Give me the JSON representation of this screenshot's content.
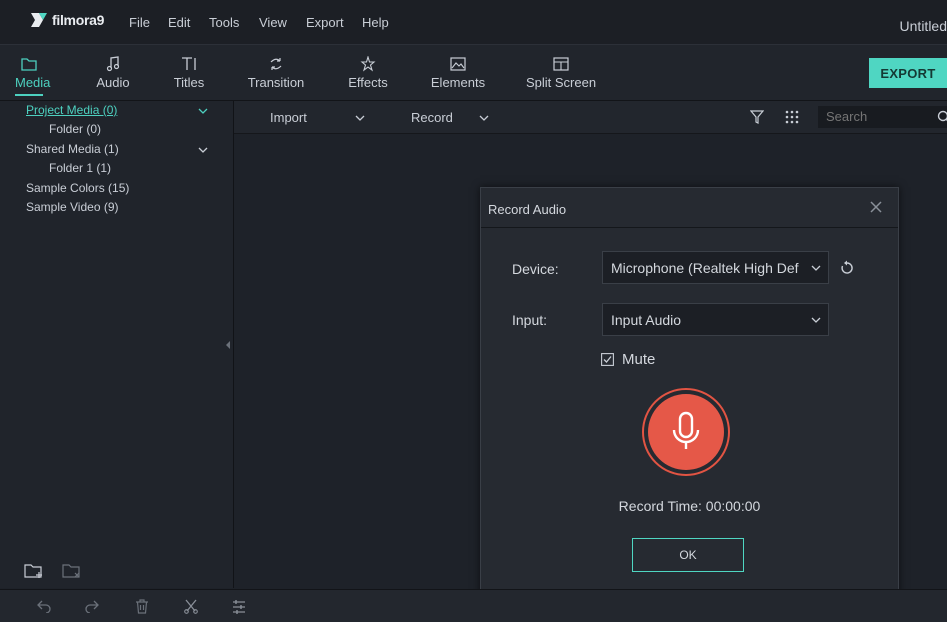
{
  "app": {
    "logo_text": "filmora9",
    "window_title": "Untitled"
  },
  "menu": [
    "File",
    "Edit",
    "Tools",
    "View",
    "Export",
    "Help"
  ],
  "toolbar": {
    "tabs": [
      {
        "label": "Media",
        "icon": "folder-icon",
        "active": true
      },
      {
        "label": "Audio",
        "icon": "music-note-icon"
      },
      {
        "label": "Titles",
        "icon": "text-icon"
      },
      {
        "label": "Transition",
        "icon": "transition-icon"
      },
      {
        "label": "Effects",
        "icon": "effects-icon"
      },
      {
        "label": "Elements",
        "icon": "image-icon"
      },
      {
        "label": "Split Screen",
        "icon": "split-screen-icon"
      }
    ],
    "export_label": "EXPORT"
  },
  "sidebar": {
    "items": [
      {
        "label": "Project Media (0)",
        "active": true
      },
      {
        "label": "Folder (0)"
      },
      {
        "label": "Shared Media (1)"
      },
      {
        "label": "Folder 1 (1)"
      },
      {
        "label": "Sample Colors (15)"
      },
      {
        "label": "Sample Video (9)"
      }
    ]
  },
  "subbar": {
    "import_label": "Import",
    "record_label": "Record",
    "search_placeholder": "Search"
  },
  "dialog": {
    "title": "Record Audio",
    "device_label": "Device:",
    "device_value": "Microphone (Realtek High Def",
    "input_label": "Input:",
    "input_value": "Input Audio",
    "mute_label": "Mute",
    "mute_checked": true,
    "record_time": "Record Time: 00:00:00",
    "ok_label": "OK"
  },
  "colors": {
    "accent": "#4fd6c2",
    "record": "#e55848",
    "background": "#1e2229"
  }
}
